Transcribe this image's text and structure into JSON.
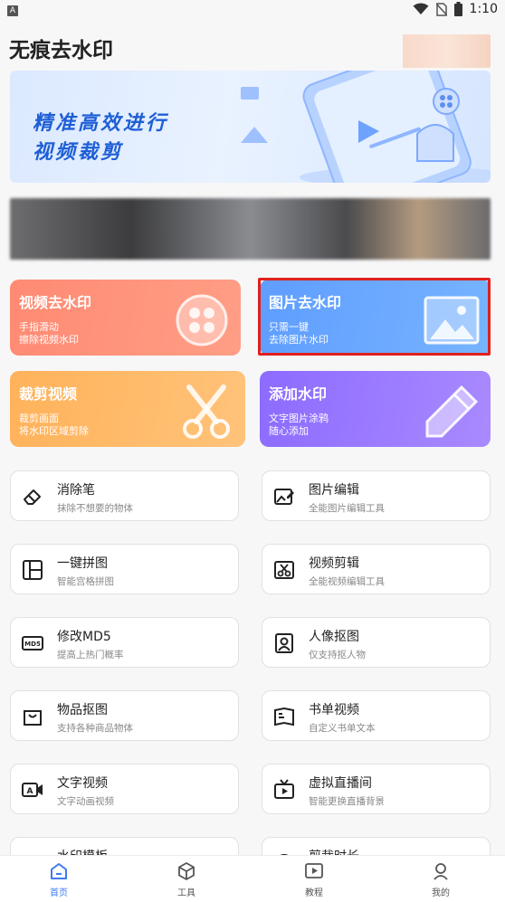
{
  "status_bar": {
    "time": "1:10",
    "notif_letter": "A"
  },
  "header": {
    "title": "无痕去水印"
  },
  "banner": {
    "line1": "精准高效进行",
    "line2": "视频裁剪"
  },
  "features": [
    {
      "title": "视频去水印",
      "sub1": "手指滑动",
      "sub2": "擦除视频水印",
      "icon": "film-reel-icon"
    },
    {
      "title": "图片去水印",
      "sub1": "只需一键",
      "sub2": "去除图片水印",
      "icon": "picture-icon"
    },
    {
      "title": "裁剪视频",
      "sub1": "裁剪画面",
      "sub2": "将水印区域剪除",
      "icon": "scissors-icon"
    },
    {
      "title": "添加水印",
      "sub1": "文字图片涂鸦",
      "sub2": "随心添加",
      "icon": "pencil-icon"
    }
  ],
  "tools": [
    {
      "title": "消除笔",
      "sub": "抹除不想要的物体",
      "icon": "eraser-icon"
    },
    {
      "title": "图片编辑",
      "sub": "全能图片编辑工具",
      "icon": "image-edit-icon"
    },
    {
      "title": "一键拼图",
      "sub": "智能宫格拼图",
      "icon": "collage-icon"
    },
    {
      "title": "视频剪辑",
      "sub": "全能视频编辑工具",
      "icon": "video-cut-icon"
    },
    {
      "title": "修改MD5",
      "sub": "提高上热门概率",
      "icon": "md5-icon",
      "icon_text": "MD5"
    },
    {
      "title": "人像抠图",
      "sub": "仅支持抠人物",
      "icon": "portrait-icon"
    },
    {
      "title": "物品抠图",
      "sub": "支持各种商品物体",
      "icon": "product-icon"
    },
    {
      "title": "书单视频",
      "sub": "自定义书单文本",
      "icon": "book-icon"
    },
    {
      "title": "文字视频",
      "sub": "文字动画视频",
      "icon": "text-video-icon"
    },
    {
      "title": "虚拟直播间",
      "sub": "智能更换直播背景",
      "icon": "tv-icon"
    },
    {
      "title": "水印模板",
      "sub": "",
      "icon": "gear-icon"
    },
    {
      "title": "剪裁时长",
      "sub": "",
      "icon": "clock-icon"
    }
  ],
  "bottom_nav": [
    {
      "label": "首页",
      "icon": "home-icon",
      "active": true
    },
    {
      "label": "工具",
      "icon": "cube-icon",
      "active": false
    },
    {
      "label": "教程",
      "icon": "play-icon",
      "active": false
    },
    {
      "label": "我的",
      "icon": "user-icon",
      "active": false
    }
  ],
  "colors": {
    "accent": "#3e7bf2",
    "video_card": "#ff8a73",
    "image_card": "#5f9dff",
    "cut_card": "#ffb25a",
    "watermark_card": "#8c6bff",
    "highlight": "#e0201c"
  }
}
